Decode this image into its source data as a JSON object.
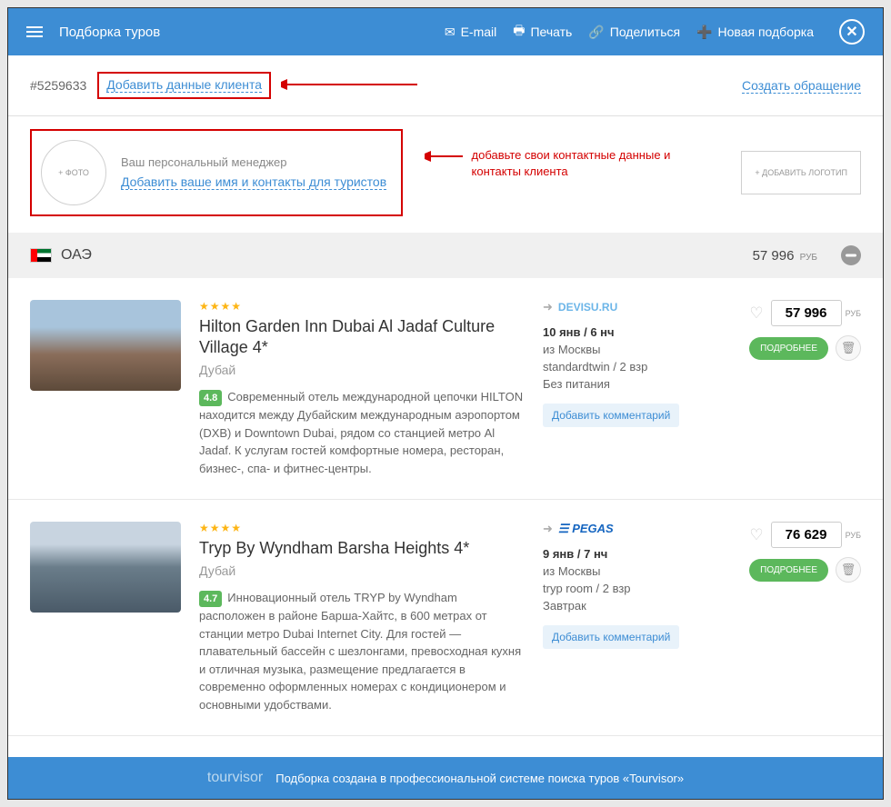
{
  "header": {
    "title": "Подборка туров",
    "email": "E-mail",
    "print": "Печать",
    "share": "Поделиться",
    "new": "Новая подборка"
  },
  "subheader": {
    "order": "#5259633",
    "add_client": "Добавить данные клиента",
    "create_request": "Создать обращение"
  },
  "manager": {
    "photo": "+ ФОТО",
    "label": "Ваш персональный менеджер",
    "add_contacts": "Добавить ваше имя и контакты для туристов",
    "annotation": "добавьте свои контактные данные и контакты клиента",
    "add_logo": "+ ДОБАВИТЬ ЛОГОТИП"
  },
  "country": {
    "name": "ОАЭ",
    "price": "57 996",
    "currency": "РУБ"
  },
  "tours": [
    {
      "stars": "★★★★",
      "name": "Hilton Garden Inn Dubai Al Jadaf Culture Village 4*",
      "city": "Дубай",
      "rating": "4.8",
      "desc": "Современный отель международной цепочки HILTON находится между Дубайским международным аэропортом (DXB) и Downtown Dubai, рядом со станцией метро Al Jadaf. К услугам гостей комфортные номера, ресторан, бизнес-, спа- и фитнес-центры.",
      "operator_html": "DEVISU",
      "date": "10 янв / 6 нч",
      "from": "из Москвы",
      "room": "standardtwin / 2 взр",
      "meal": "Без питания",
      "comment": "Добавить комментарий",
      "price": "57 996",
      "details": "ПОДРОБНЕЕ"
    },
    {
      "stars": "★★★★",
      "name": "Tryp By Wyndham Barsha Heights 4*",
      "city": "Дубай",
      "rating": "4.7",
      "desc": "Инновационный отель TRYP by Wyndham расположен в районе Барша-Хайтс, в 600 метрах от станции метро Dubai Internet City. Для гостей — плавательный бассейн с шезлонгами, превосходная кухня и отличная музыка, размещение предлагается в современно оформленных номерах с кондиционером и основными удобствами.",
      "operator_html": "PEGAS",
      "date": "9 янв / 7 нч",
      "from": "из Москвы",
      "room": "tryp room / 2 взр",
      "meal": "Завтрак",
      "comment": "Добавить комментарий",
      "price": "76 629",
      "details": "ПОДРОБНЕЕ"
    }
  ],
  "footer": {
    "logo": "tourvisor",
    "text": "Подборка создана в профессиональной системе поиска туров «Tourvisor»"
  },
  "currency": "РУБ"
}
